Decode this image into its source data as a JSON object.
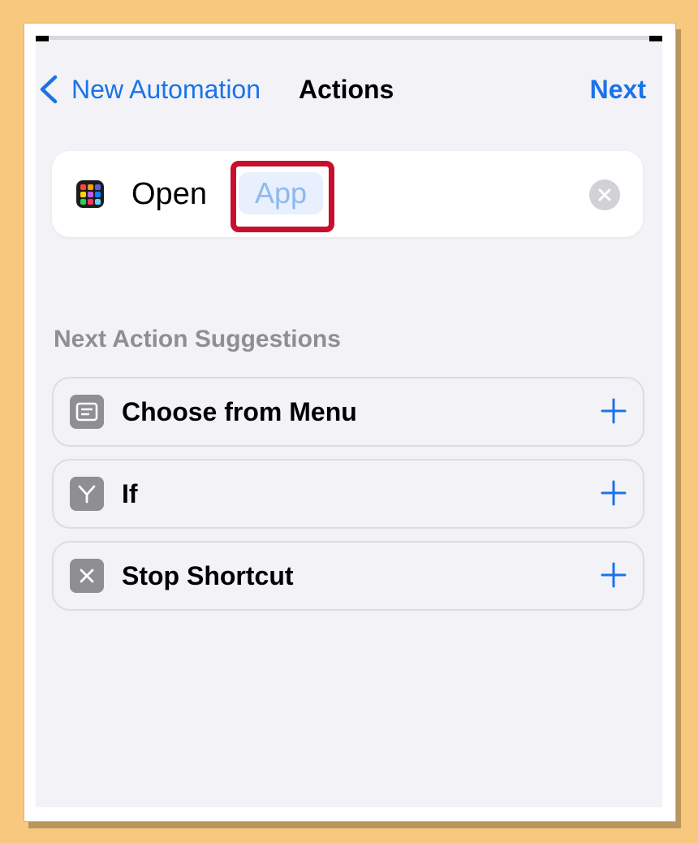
{
  "nav": {
    "back_label": "New Automation",
    "title": "Actions",
    "next_label": "Next"
  },
  "action": {
    "verb": "Open",
    "parameter_placeholder": "App",
    "icon": "app-grid-icon"
  },
  "suggestions": {
    "header": "Next Action Suggestions",
    "items": [
      {
        "label": "Choose from Menu",
        "icon": "menu-icon"
      },
      {
        "label": "If",
        "icon": "branch-icon"
      },
      {
        "label": "Stop Shortcut",
        "icon": "stop-icon"
      }
    ]
  },
  "colors": {
    "accent": "#1a73e8",
    "highlight": "#c8102e",
    "token_bg": "#e7f0fc",
    "token_text": "#8fb8ef"
  }
}
